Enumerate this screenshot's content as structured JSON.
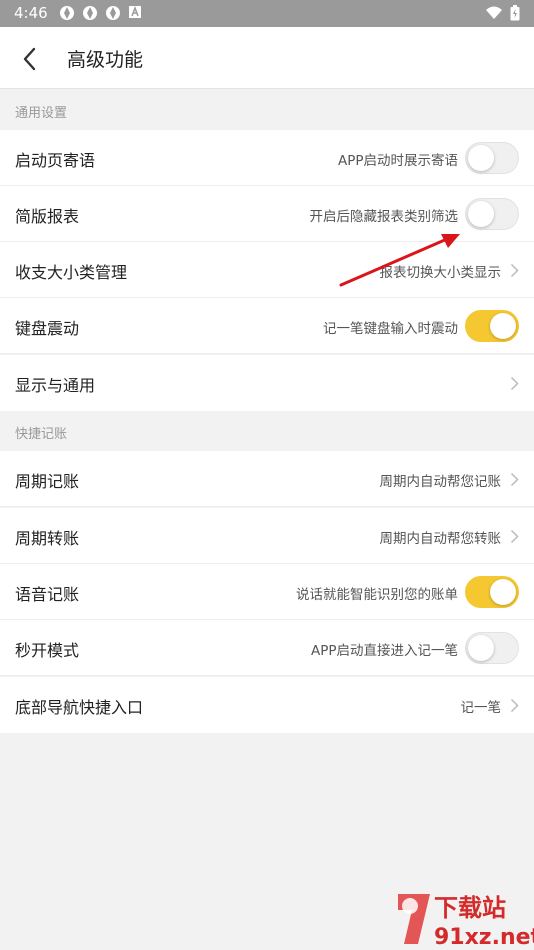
{
  "status_bar": {
    "time": "4:46",
    "icons": [
      "gear-notification-icon",
      "gear-notification-icon",
      "gear-notification-icon",
      "a-notification-icon"
    ],
    "right_icons": [
      "wifi-icon",
      "battery-icon"
    ]
  },
  "header": {
    "title": "高级功能",
    "back_icon": "chevron-left-icon"
  },
  "sections": [
    {
      "title": "通用设置",
      "rows": [
        {
          "label": "启动页寄语",
          "desc": "APP启动时展示寄语",
          "control": "toggle",
          "on": false
        },
        {
          "label": "简版报表",
          "desc": "开启后隐藏报表类别筛选",
          "control": "toggle",
          "on": false
        },
        {
          "label": "收支大小类管理",
          "desc": "报表切换大小类显示",
          "control": "chevron"
        },
        {
          "label": "键盘震动",
          "desc": "记一笔键盘输入时震动",
          "control": "toggle",
          "on": true
        },
        {
          "label": "显示与通用",
          "desc": "",
          "control": "chevron"
        }
      ]
    },
    {
      "title": "快捷记账",
      "rows": [
        {
          "label": "周期记账",
          "desc": "周期内自动帮您记账",
          "control": "chevron"
        },
        {
          "label": "周期转账",
          "desc": "周期内自动帮您转账",
          "control": "chevron"
        },
        {
          "label": "语音记账",
          "desc": "说话就能智能识别您的账单",
          "control": "toggle",
          "on": true
        },
        {
          "label": "秒开模式",
          "desc": "APP启动直接进入记一笔",
          "control": "toggle",
          "on": false
        },
        {
          "label": "底部导航快捷入口",
          "desc": "记一笔",
          "control": "chevron"
        }
      ]
    }
  ],
  "colors": {
    "toggle_on": "#f5c832",
    "annotation_arrow": "#d9161c",
    "status_bar": "#9a9a9a"
  },
  "watermark": {
    "text_top": "下载站",
    "text_bottom": "91xz.net"
  }
}
